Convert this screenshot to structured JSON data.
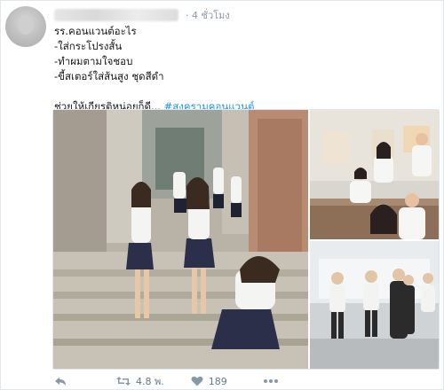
{
  "tweet": {
    "timestamp": "· 4 ชั่วโมง",
    "lines": [
      "รร.คอนแวนต์อะไร",
      "-ใส่กระโปรงสั้น",
      "-ทำผมตามใจชอบ",
      "-ขี้สเตอร์ใส่ส้นสูง ชุดสีดำ"
    ],
    "closing_text": "ช่วยให้เกียรติหน่อยก็ดี...",
    "hashtag": "#สงครามคอนแวนต์"
  },
  "actions": {
    "retweet_count": "4.8 พ.",
    "like_count": "189"
  },
  "icons": [
    "reply-icon",
    "retweet-icon",
    "like-icon",
    "more-icon"
  ],
  "colors": {
    "hashtag": "#1b95e0",
    "meta": "#8899a6",
    "icon": "#8899a6"
  }
}
